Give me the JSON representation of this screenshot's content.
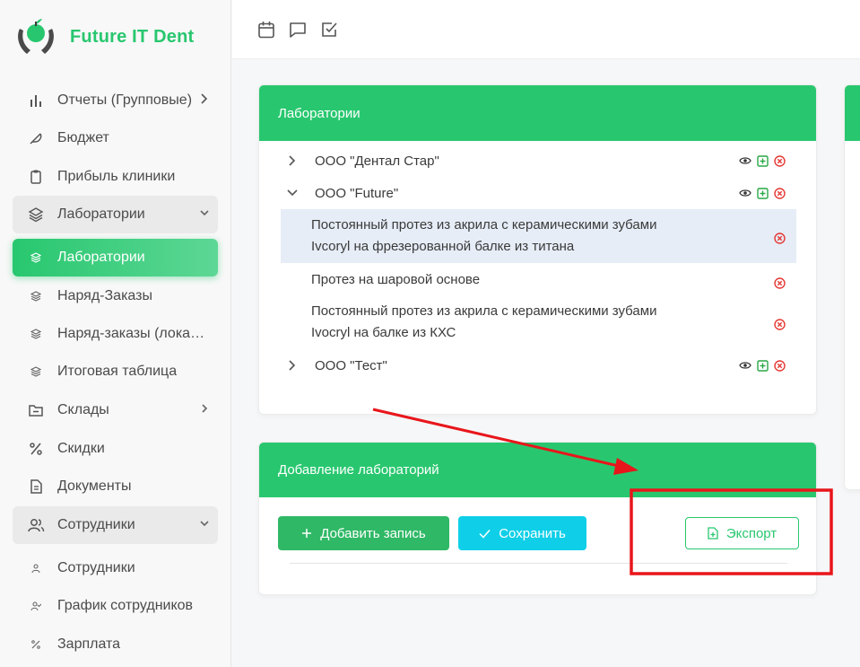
{
  "brand": {
    "name": "Future IT Dent"
  },
  "sidebar": {
    "items": [
      {
        "label": "Отчеты (Групповые)",
        "icon": "bar-chart-icon"
      },
      {
        "label": "Бюджет",
        "icon": "feather-icon"
      },
      {
        "label": "Прибыль клиники",
        "icon": "clipboard-icon"
      },
      {
        "label": "Лаборатории",
        "icon": "layers-icon"
      },
      {
        "label": "Лаборатории",
        "icon": "layers-small-icon"
      },
      {
        "label": "Наряд-Заказы",
        "icon": "layers-small-icon"
      },
      {
        "label": "Наряд-заказы (локальные)",
        "icon": "layers-small-icon"
      },
      {
        "label": "Итоговая таблица",
        "icon": "layers-small-icon"
      },
      {
        "label": "Склады",
        "icon": "folder-icon"
      },
      {
        "label": "Скидки",
        "icon": "percent-icon"
      },
      {
        "label": "Документы",
        "icon": "file-text-icon"
      },
      {
        "label": "Сотрудники",
        "icon": "users-icon"
      },
      {
        "label": "Сотрудники",
        "icon": "user-small-icon"
      },
      {
        "label": "График сотрудников",
        "icon": "user-check-small-icon"
      },
      {
        "label": "Зарплата",
        "icon": "percent-small-icon"
      }
    ]
  },
  "topbar": {
    "icons": [
      "calendar-icon",
      "message-square-icon",
      "check-square-icon"
    ]
  },
  "labs_card": {
    "title": "Лаборатории",
    "labs": [
      {
        "name": "ООО \"Дентал Стар\"",
        "expanded": false
      },
      {
        "name": "ООО \"Future\"",
        "expanded": true,
        "children": [
          {
            "line1": "Постоянный протез из акрила с керамическими зубами",
            "line2": "Ivcoryl на фрезерованной балке из титана",
            "selected": true
          },
          {
            "line1": "Протез на шаровой основе",
            "line2": "",
            "selected": false
          },
          {
            "line1": "Постоянный протез из акрила с керамическими зубами",
            "line2": "Ivocryl на балке из КХС",
            "selected": false
          }
        ]
      },
      {
        "name": "ООО \"Тест\"",
        "expanded": false
      }
    ]
  },
  "add_card": {
    "title": "Добавление лабораторий",
    "add_label": "Добавить запись",
    "save_label": "Сохранить",
    "export_label": "Экспорт"
  },
  "colors": {
    "accent": "#28c76f",
    "save": "#0fcfe8",
    "annotation": "#e8161b"
  }
}
